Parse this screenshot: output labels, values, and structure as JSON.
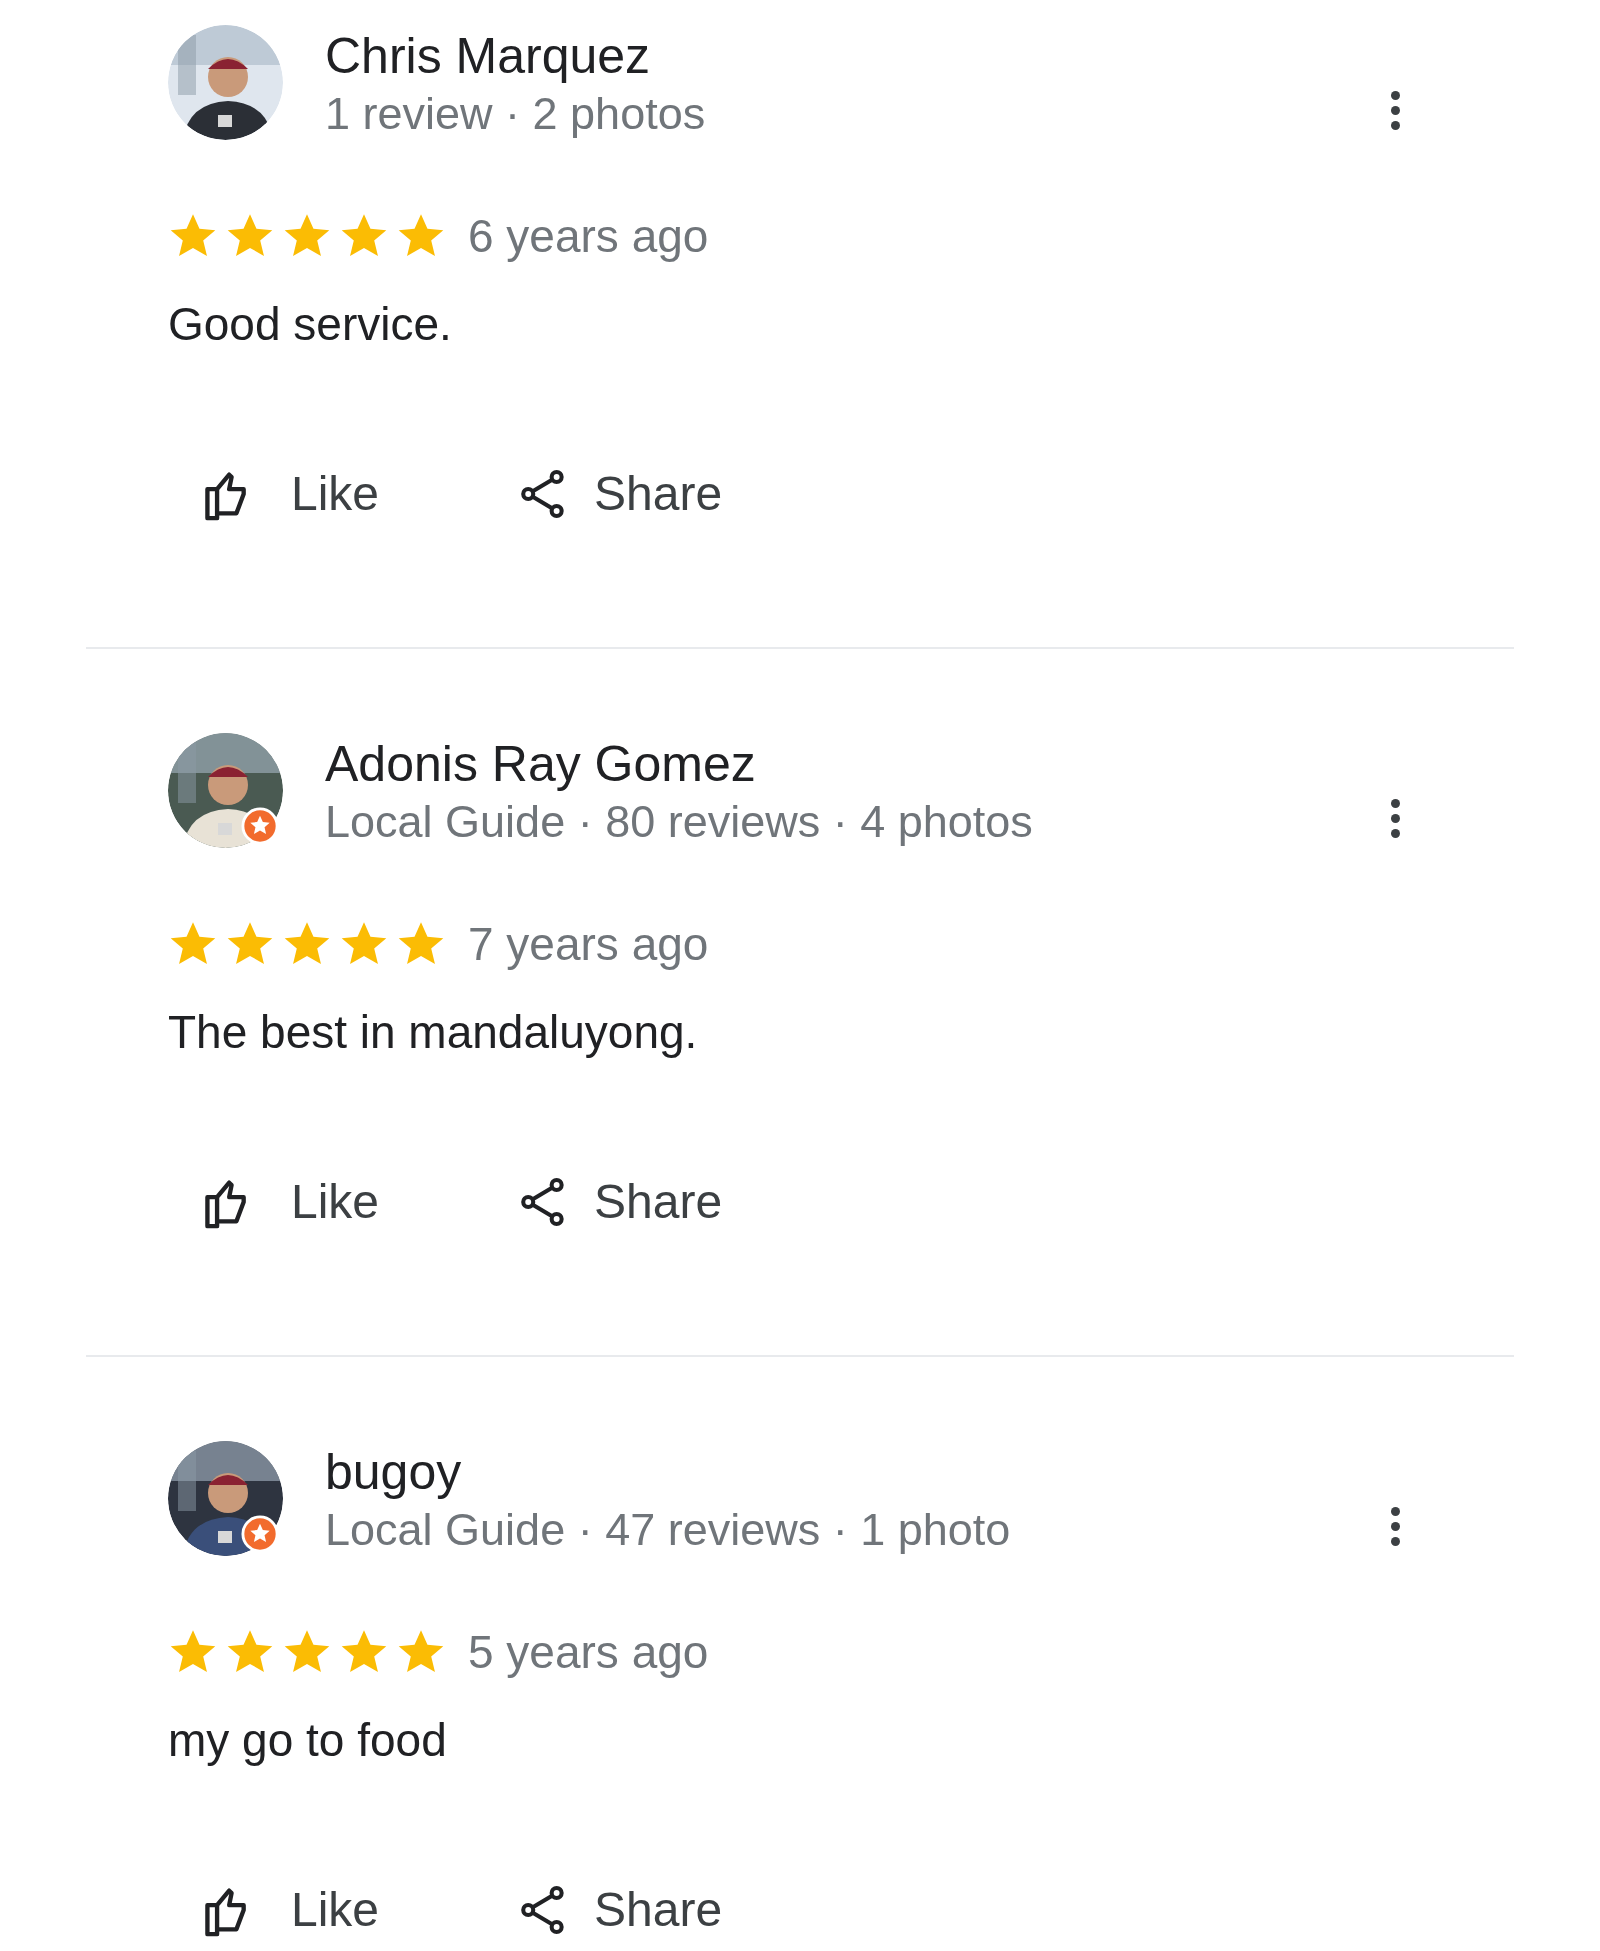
{
  "reviews": [
    {
      "name": "Chris Marquez",
      "meta": "1 review · 2 photos",
      "local_guide": false,
      "stars": 5,
      "time": "6 years ago",
      "text": "Good service.",
      "actions": [
        "Like",
        "Share"
      ]
    },
    {
      "name": "Adonis Ray Gomez",
      "meta": "Local Guide · 80 reviews · 4 photos",
      "local_guide": true,
      "stars": 5,
      "time": "7 years ago",
      "text": "The best in mandaluyong.",
      "actions": [
        "Like",
        "Share"
      ]
    },
    {
      "name": "bugoy",
      "meta": "Local Guide · 47 reviews · 1 photo",
      "local_guide": true,
      "stars": 5,
      "time": "5 years ago",
      "text": "my go to food",
      "actions": [
        "Like",
        "Share"
      ]
    }
  ]
}
